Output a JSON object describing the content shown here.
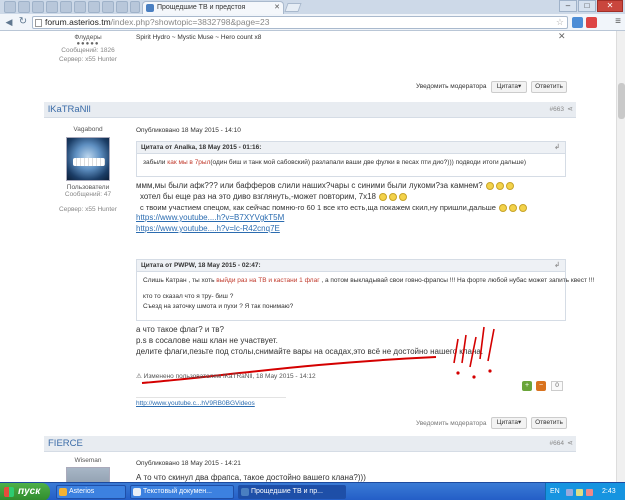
{
  "browser": {
    "tab_title": "Прощедшие ТВ и предстоя",
    "url_host": "forum.asterios.tm",
    "url_path": "/index.php?showtopic=3832798&page=23"
  },
  "prev_post": {
    "group": "Флудеры",
    "messages": "Сообщений: 1826",
    "server": "Сервер: x55 Hunter",
    "signature": "Spirit Hydro ~ Mystic Muse ~ Hero count x8",
    "report": "Уведомить модератора",
    "quote": "Цитата",
    "reply": "Ответить"
  },
  "post663": {
    "author": "lKaTRaNll",
    "number": "#663",
    "group": "Vagabond",
    "role": "Пользователи",
    "messages": "Сообщений: 47",
    "server": "Сервер: x55 Hunter",
    "published": "Опубликовано 18 May 2015 - 14:10",
    "quote1_head": "Цитата от Analka, 18 May 2015 - 01:16:",
    "quote1_a": "забыли ",
    "quote1_red": "как мы в 7рыл",
    "quote1_b": "(один биш и танк мой сабовский) разлапали ваши две фулки в песах пти дио?))) подводи итоги дальше)",
    "line1": "ммм,мы были афк??? или бафферов слили наших?чары с синими были лукоми?за камнем?",
    "line2": "хотел бы еще раз на это диво взглянуть,-может повторим, 7х18",
    "line3": "с твоим участием спецом, как сейчас помню-го 60 1  все кто есть,ща покажем скил,ну пришли,дальше",
    "link1": "https://www.youtube....h?v=B7XYVgkT5M",
    "link2": "https://www.youtube....h?v=lc-R42cnq7E",
    "quote2_head": "Цитата от PWPW, 18 May 2015 - 02:47:",
    "quote2_a": "Слишь Катран , ты хоть ",
    "quote2_red": "выйди раз на ТВ и кастани 1 флаг",
    "quote2_b": " , а потом выкладывай свои говно-фрапсы !!! На форте любой нубас может запить квест !!!",
    "quote2_c": "кто то сказал что я тру- биш ?",
    "quote2_d": "Съезд на заточку шмота и пухи ? Я так понимаю?",
    "line4": "а что такое флаг? и тв?",
    "line5": "р.s в сосалове наш клан не участвует.",
    "line6": "делите флаги,пезьте под столы,снимайте вары на осадах,это всё не достойно нашего клана.",
    "edited": "Изменено пользователем lKaTRaNll, 18 May 2015 - 14:12",
    "vote_count": "0",
    "sig_link": "http://www.youtube.c...hV9RB0BGVideos",
    "report": "Уведомить модератора",
    "quote": "Цитата",
    "reply": "Ответить"
  },
  "post664": {
    "author": "FIERCE",
    "number": "#664",
    "group": "Wiseman",
    "published": "Опубликовано 18 May 2015 - 14:21",
    "line1": "А то что  скинул два фрапса, такое достойно вашего клана?)))"
  },
  "taskbar": {
    "start": "пуск",
    "task1": "Asterios",
    "task2": "Текстовый докумен...",
    "task3": "Прощедшие ТВ и пр...",
    "lang": "EN",
    "clock": "2:43"
  },
  "colors": {
    "accent_link": "#2b6cb0",
    "author": "#3b6ca8",
    "quote_highlight": "#c0392b",
    "scribble": "#d40000"
  }
}
